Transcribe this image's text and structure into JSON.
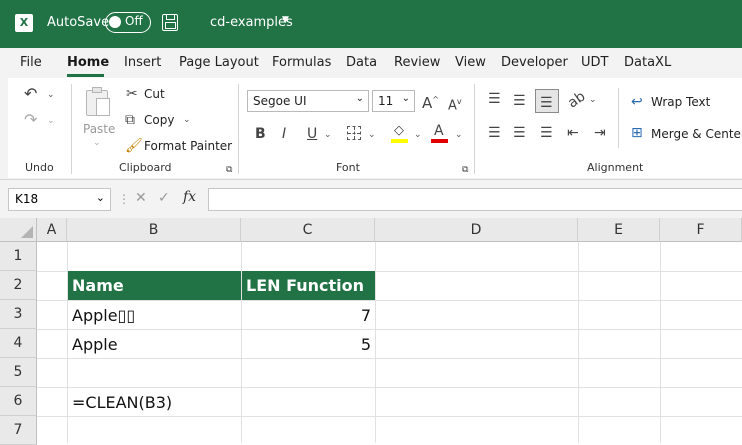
{
  "titlebar": {
    "autosave_label": "AutoSave",
    "autosave_state": "Off",
    "doc_title": "cd-examples"
  },
  "tabs": [
    "File",
    "Home",
    "Insert",
    "Page Layout",
    "Formulas",
    "Data",
    "Review",
    "View",
    "Developer",
    "UDT",
    "DataXL"
  ],
  "active_tab": "Home",
  "ribbon": {
    "undo_group": "Undo",
    "clipboard": {
      "group": "Clipboard",
      "paste": "Paste",
      "cut": "Cut",
      "copy": "Copy",
      "format_painter": "Format Painter"
    },
    "font": {
      "group": "Font",
      "font_name": "Segoe UI",
      "font_size": "11",
      "bold": "B",
      "italic": "I",
      "underline": "U",
      "font_color_glyph": "A",
      "grow_glyph": "A",
      "shrink_glyph": "A"
    },
    "alignment": {
      "group": "Alignment",
      "wrap_text": "Wrap Text",
      "merge_center": "Merge & Center"
    }
  },
  "formula_bar": {
    "name_box": "K18",
    "fx": "fx",
    "formula": ""
  },
  "columns": [
    "A",
    "B",
    "C",
    "D",
    "E",
    "F"
  ],
  "rows": [
    "1",
    "2",
    "3",
    "4",
    "5",
    "6",
    "7"
  ],
  "cells": {
    "B2": "Name",
    "C2": "LEN Function",
    "B3": "Apple▯▯",
    "C3": "7",
    "B4": "Apple",
    "C4": "5",
    "B6": "=CLEAN(B3)"
  },
  "colors": {
    "accent": "#217346",
    "font_color_bar": "#e00000",
    "highlight_bar": "#ffff00"
  }
}
